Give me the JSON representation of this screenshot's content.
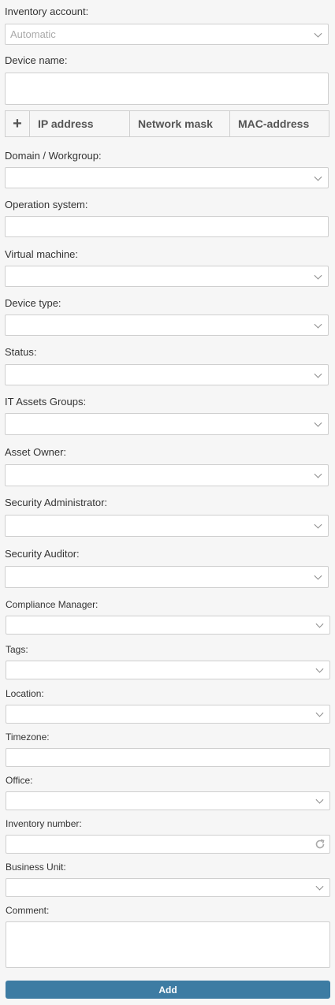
{
  "fields": {
    "inventory_account": {
      "label": "Inventory account:",
      "value": "Automatic"
    },
    "device_name": {
      "label": "Device name:"
    },
    "domain_workgroup": {
      "label": "Domain / Workgroup:"
    },
    "operation_system": {
      "label": "Operation system:"
    },
    "virtual_machine": {
      "label": "Virtual machine:"
    },
    "device_type": {
      "label": "Device type:"
    },
    "status": {
      "label": "Status:"
    },
    "it_assets_groups": {
      "label": "IT Assets Groups:"
    },
    "asset_owner": {
      "label": "Asset Owner:"
    },
    "security_administrator": {
      "label": "Security Administrator:"
    },
    "security_auditor": {
      "label": "Security Auditor:"
    },
    "compliance_manager": {
      "label": "Compliance Manager:"
    },
    "tags": {
      "label": "Tags:"
    },
    "location": {
      "label": "Location:"
    },
    "timezone": {
      "label": "Timezone:"
    },
    "office": {
      "label": "Office:"
    },
    "inventory_number": {
      "label": "Inventory number:"
    },
    "business_unit": {
      "label": "Business Unit:"
    },
    "comment": {
      "label": "Comment:"
    }
  },
  "ip_table": {
    "add_symbol": "+",
    "columns": [
      "IP address",
      "Network mask",
      "MAC-address"
    ]
  },
  "icons": {
    "dropdown": "chevron-down-icon",
    "add": "plus-icon",
    "refresh": "refresh-icon"
  },
  "colors": {
    "background": "#f6f6f6",
    "primary_button": "#3d7ca3",
    "border": "#cfcfcf"
  },
  "actions": {
    "add_label": "Add"
  }
}
